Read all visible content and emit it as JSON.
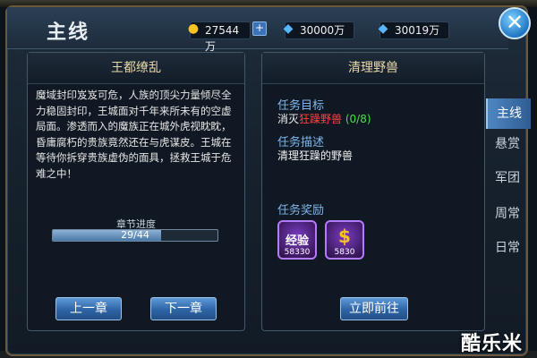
{
  "window": {
    "title": "主线"
  },
  "resources": {
    "gold": {
      "icon": "gold-coin-icon",
      "value": "27544万"
    },
    "gem_bound": {
      "icon": "bound-diamond-icon",
      "value": "30000万"
    },
    "gem": {
      "icon": "diamond-icon",
      "value": "30019万"
    }
  },
  "chapter": {
    "title": "王都缭乱",
    "story": "魔域封印岌岌可危，人族的顶尖力量倾尽全力稳固封印，王城面对千年来所未有的空虚局面。渗透而入的魔族正在城外虎视眈眈，昏庸腐朽的贵族竟然还在与虎谋皮。王城在等待你拆穿贵族虚伪的面具，拯救王城于危难之中！",
    "progress_label": "章节进度",
    "progress_current": 29,
    "progress_total": 44,
    "progress_text": "29/44",
    "prev_label": "上一章",
    "next_label": "下一章"
  },
  "quest": {
    "title": "清理野兽",
    "objective_label": "任务目标",
    "objective_prefix": "消灭",
    "objective_target": "狂躁野兽",
    "objective_count": "(0/8)",
    "desc_label": "任务描述",
    "desc": "清理狂躁的野兽",
    "reward_label": "任务奖励",
    "rewards": [
      {
        "icon": "exp-icon",
        "glyph": "经验",
        "count": "58330"
      },
      {
        "icon": "gold-coin-icon",
        "glyph": "$",
        "count": "5830"
      }
    ],
    "go_label": "立即前往"
  },
  "tabs": [
    "主线",
    "悬赏",
    "军团",
    "周常",
    "日常"
  ],
  "active_tab": 0,
  "watermark": "酷乐米",
  "colors": {
    "accent": "#3a73b8",
    "objective_target": "#ff4040",
    "objective_count": "#4fdc4f",
    "label": "#7fb6ea"
  }
}
